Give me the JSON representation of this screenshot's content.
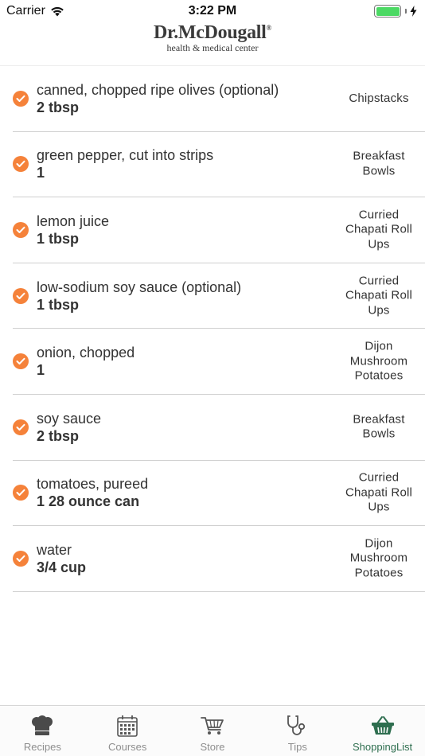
{
  "status": {
    "carrier": "Carrier",
    "time": "3:22 PM"
  },
  "header": {
    "title": "Dr.McDougall",
    "registered": "®",
    "subtitle": "health & medical center"
  },
  "items": [
    {
      "name": "canned, chopped ripe olives (optional)",
      "qty": "2 tbsp",
      "recipe": "Chipstacks"
    },
    {
      "name": "green pepper, cut into strips",
      "qty": "1",
      "recipe": "Breakfast Bowls"
    },
    {
      "name": "lemon juice",
      "qty": "1 tbsp",
      "recipe": "Curried Chapati Roll Ups"
    },
    {
      "name": "low-sodium soy sauce (optional)",
      "qty": "1 tbsp",
      "recipe": "Curried Chapati Roll Ups"
    },
    {
      "name": "onion, chopped",
      "qty": "1",
      "recipe": "Dijon Mushroom Potatoes"
    },
    {
      "name": "soy sauce",
      "qty": "2 tbsp",
      "recipe": "Breakfast Bowls"
    },
    {
      "name": "tomatoes, pureed",
      "qty": "1 28 ounce can",
      "recipe": "Curried Chapati Roll Ups"
    },
    {
      "name": "water",
      "qty": "3/4 cup",
      "recipe": "Dijon Mushroom Potatoes"
    }
  ],
  "tabs": [
    {
      "label": "Recipes",
      "icon": "chef-hat-icon",
      "active": false
    },
    {
      "label": "Courses",
      "icon": "calendar-icon",
      "active": false
    },
    {
      "label": "Store",
      "icon": "cart-icon",
      "active": false
    },
    {
      "label": "Tips",
      "icon": "stethoscope-icon",
      "active": false
    },
    {
      "label": "ShoppingList",
      "icon": "basket-icon",
      "active": true
    }
  ],
  "colors": {
    "accent": "#f5823a",
    "active_tab": "#2e6e4f",
    "inactive_tab": "#8e8e8e",
    "battery": "#4cd964"
  }
}
